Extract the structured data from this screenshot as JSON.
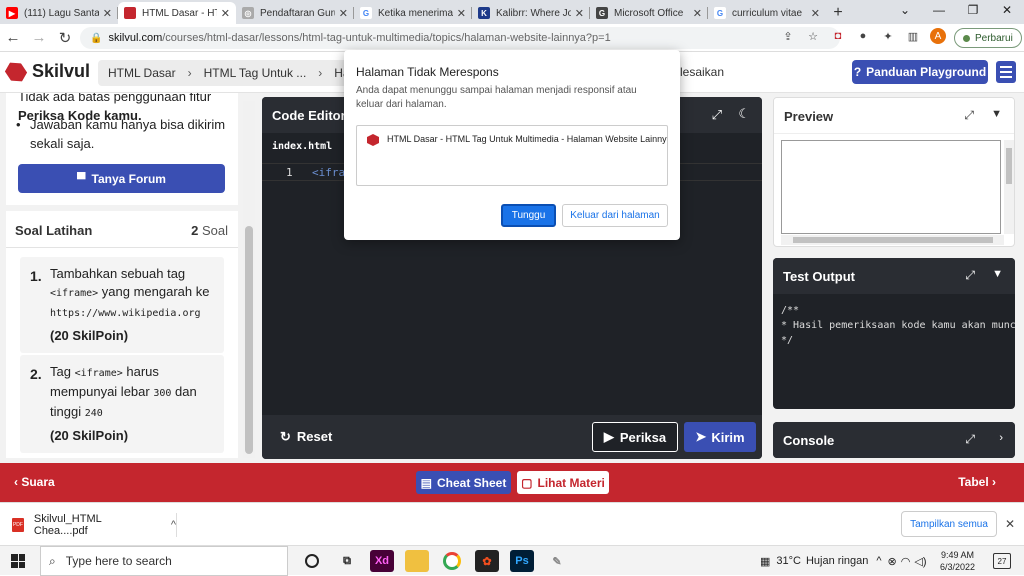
{
  "browser": {
    "tabs": [
      {
        "title": "(111) Lagu Santai",
        "icon": "youtube-icon",
        "color": "#ff0000"
      },
      {
        "title": "HTML Dasar - HT",
        "icon": "skilvul-icon",
        "color": "#c4262e"
      },
      {
        "title": "Pendaftaran Guru",
        "icon": "globe-icon",
        "color": "#888888"
      },
      {
        "title": "Ketika menerima",
        "icon": "google-icon",
        "color": "#4285f4"
      },
      {
        "title": "Kalibrr: Where Jo",
        "icon": "kalibrr-icon",
        "color": "#1e3a8a"
      },
      {
        "title": "Microsoft Office",
        "icon": "office-icon",
        "color": "#444444"
      },
      {
        "title": "curriculum vitae",
        "icon": "google-icon",
        "color": "#4285f4"
      }
    ],
    "url_domain": "skilvul.com",
    "url_path": "/courses/html-dasar/lessons/html-tag-untuk-multimedia/topics/halaman-website-lainnya?p=1",
    "profile_initial": "A",
    "update_label": "Perbarui"
  },
  "site": {
    "logo_text": "Skilvul",
    "breadcrumb": [
      "HTML Dasar",
      "HTML Tag Untuk ...",
      "Hala"
    ],
    "breadcrumb_end": "lesaikan",
    "playground_button": "Panduan Playground",
    "instructions": {
      "partial_line": "Tidak ada batas penggunaan fitur",
      "bold_line": "Periksa Kode kamu.",
      "bullet": "Jawaban kamu hanya bisa dikirim sekali saja."
    },
    "forum_button": "Tanya Forum",
    "exercise": {
      "heading": "Soal Latihan",
      "count": "2",
      "count_unit": "Soal",
      "questions": [
        {
          "num": "1.",
          "pre": "Tambahkan sebuah tag",
          "code1": "<iframe>",
          "mid": "yang mengarah ke",
          "code2": "https://www.wikipedia.org",
          "points": "(20 SkilPoin)"
        },
        {
          "num": "2.",
          "pre": "Tag",
          "code1": "<iframe>",
          "mid": "harus mempunyai lebar",
          "code2": "300",
          "mid2": "dan tinggi",
          "code3": "240",
          "points": "(20 SkilPoin)"
        }
      ]
    },
    "editor": {
      "title": "Code Editor",
      "file": "index.html",
      "line_no": "1",
      "code": "<ifra",
      "reset": "Reset",
      "check": "Periksa",
      "submit": "Kirim"
    },
    "preview": {
      "title": "Preview"
    },
    "test_output": {
      "title": "Test Output",
      "text": "/**\n* Hasil pemeriksaan kode kamu akan muncul\n*/"
    },
    "console": {
      "title": "Console"
    },
    "bottom": {
      "prev": "Suara",
      "cheat": "Cheat Sheet",
      "materi": "Lihat Materi",
      "next": "Tabel"
    }
  },
  "dialog": {
    "title": "Halaman Tidak Merespons",
    "message": "Anda dapat menunggu sampai halaman menjadi responsif atau keluar dari halaman.",
    "page": "HTML Dasar - HTML Tag Untuk Multimedia - Halaman Website Lainnya",
    "wait": "Tunggu",
    "leave": "Keluar dari halaman"
  },
  "downloads": {
    "file": "Skilvul_HTML Chea....pdf",
    "show_all": "Tampilkan semua"
  },
  "taskbar": {
    "search_placeholder": "Type here to search",
    "temp": "31°C",
    "weather": "Hujan ringan",
    "time": "9:49 AM",
    "date": "6/3/2022",
    "notif_count": "27"
  }
}
